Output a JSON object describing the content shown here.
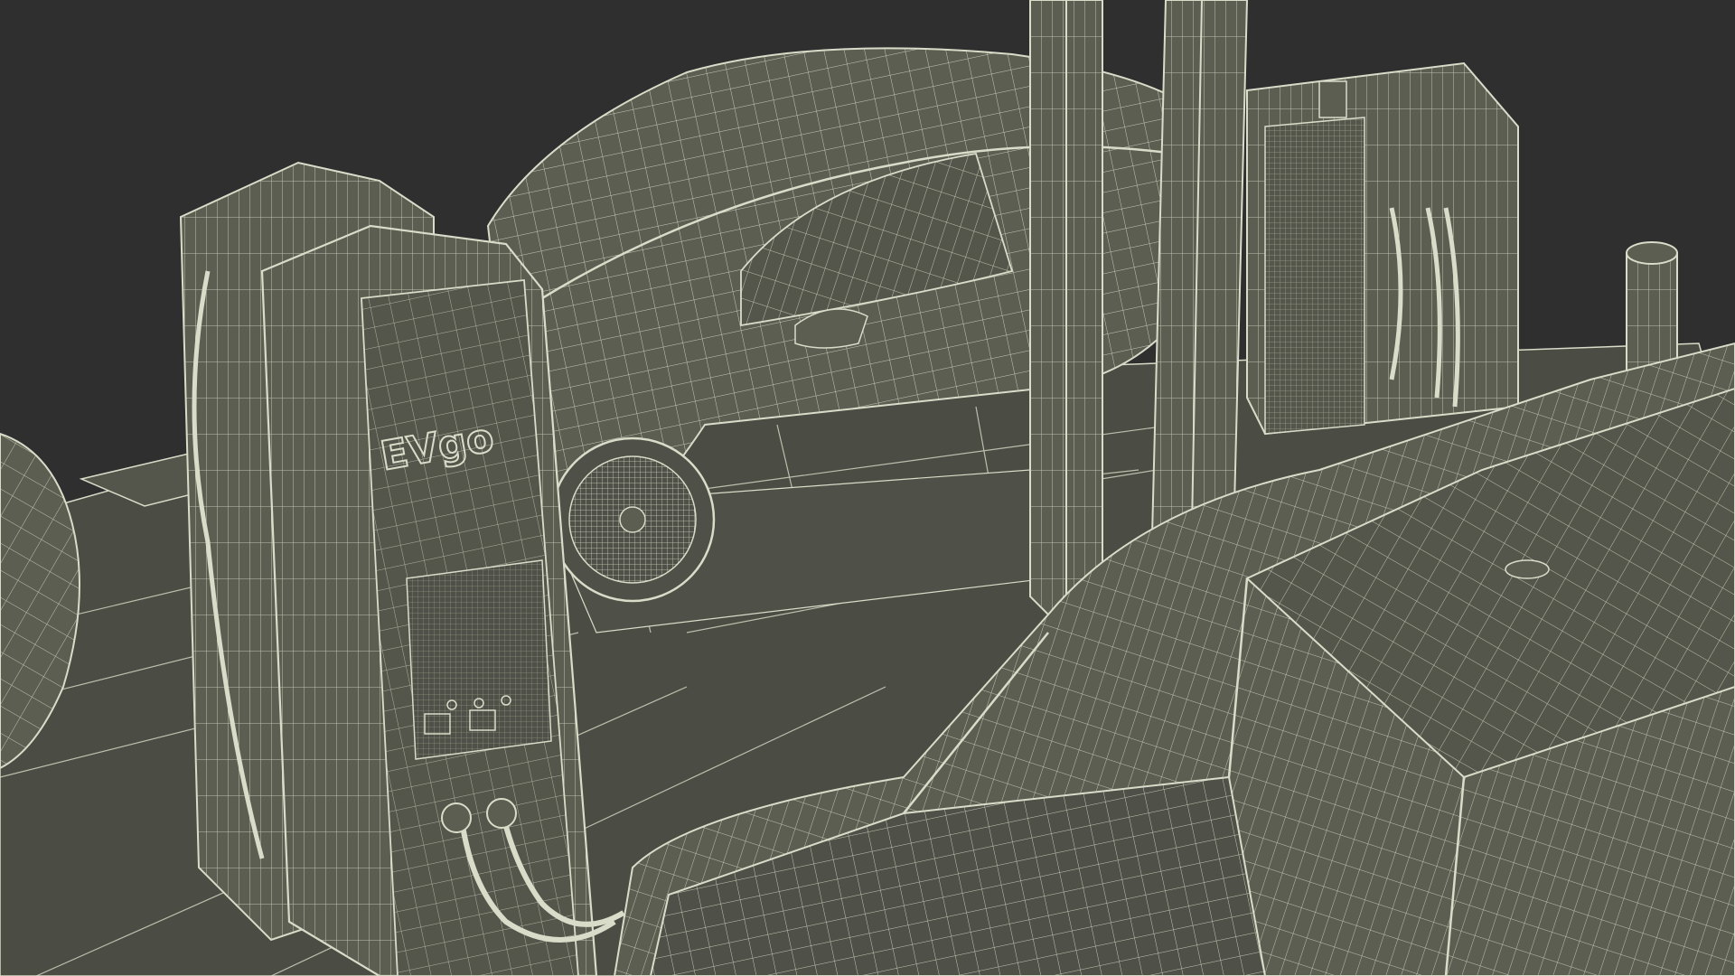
{
  "scene": {
    "background_color": "#2f2f2f",
    "ground_color": "#4b4c43",
    "mesh_fill": "#5d5e52",
    "mesh_fill_dark": "#55564b",
    "wire_color": "#d8dcc8",
    "wire_color_dim": "#b9bca9",
    "objects": [
      "ev-charging-station-wireframe",
      "sedan-wireframe",
      "pickup-truck-wireframe",
      "charger-pillar-left",
      "charger-pillar-right",
      "support-column",
      "bollard"
    ]
  },
  "branding": {
    "charger_logo": "EVgo"
  }
}
